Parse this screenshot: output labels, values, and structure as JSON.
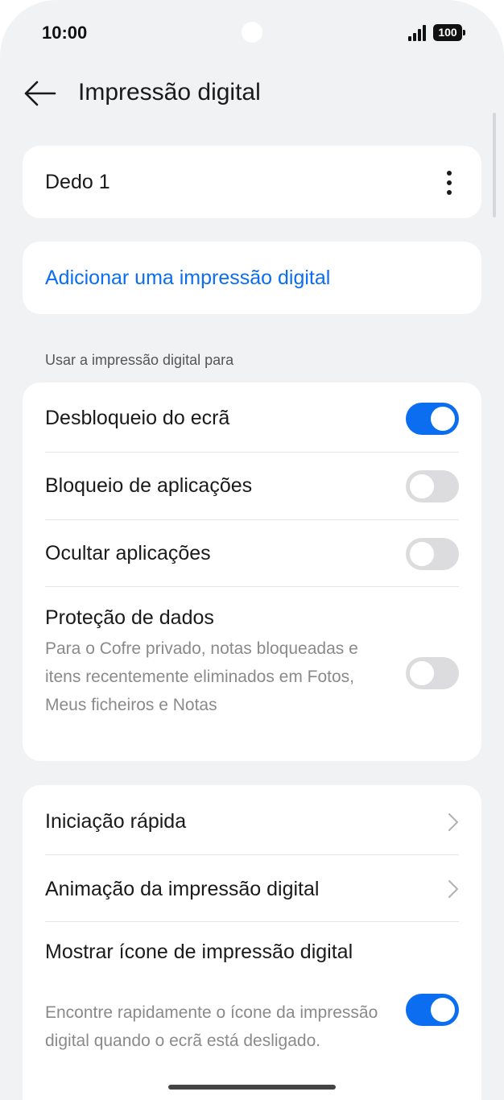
{
  "status": {
    "time": "10:00",
    "battery": "100"
  },
  "header": {
    "title": "Impressão digital"
  },
  "fingerprints": [
    {
      "label": "Dedo 1"
    }
  ],
  "add_fingerprint": {
    "label": "Adicionar uma impressão digital"
  },
  "use_section": {
    "title": "Usar a impressão digital para",
    "items": [
      {
        "label": "Desbloqueio do ecrã",
        "enabled": true
      },
      {
        "label": "Bloqueio de aplicações",
        "enabled": false
      },
      {
        "label": "Ocultar aplicações",
        "enabled": false
      },
      {
        "label": "Proteção de dados",
        "description": "Para o Cofre privado, notas bloqueadas e itens recentemente eliminados em Fotos, Meus ficheiros e Notas",
        "enabled": false
      }
    ]
  },
  "more_settings": {
    "items": [
      {
        "label": "Iniciação rápida"
      },
      {
        "label": "Animação da impressão digital"
      },
      {
        "label": "Mostrar ícone de impressão digital",
        "description": "Encontre rapidamente o ícone da impressão digital quando o ecrã está desligado.",
        "enabled": true
      }
    ]
  },
  "icons": {
    "back": "arrow-left-icon",
    "more": "more-vertical-icon",
    "chevron": "chevron-right-icon",
    "signal": "cellular-signal-icon",
    "battery": "battery-icon"
  },
  "colors": {
    "accent": "#0b6ef0",
    "background": "#f1f2f4",
    "toggle_off": "#dcdcde"
  }
}
